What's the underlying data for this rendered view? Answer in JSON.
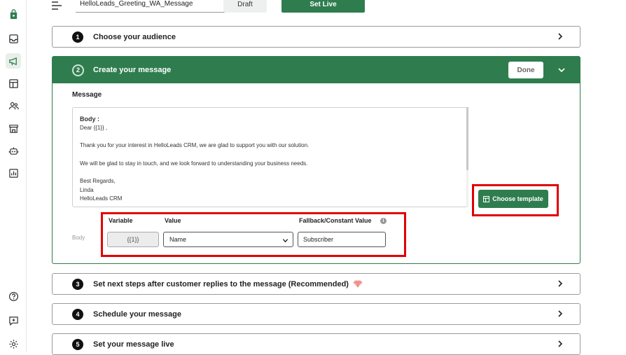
{
  "toolbar": {
    "campaign_name": "HelloLeads_Greeting_WA_Message",
    "draft_label": "Draft",
    "set_live_label": "Set Live"
  },
  "steps": [
    {
      "num": "1",
      "title": "Choose your audience"
    },
    {
      "num": "2",
      "title": "Create your message",
      "done_label": "Done"
    },
    {
      "num": "3",
      "title": "Set next steps after customer replies to the message (Recommended)"
    },
    {
      "num": "4",
      "title": "Schedule your message"
    },
    {
      "num": "5",
      "title": "Set your message live"
    }
  ],
  "message": {
    "label": "Message",
    "body_heading": "Body :",
    "line_dear": "Dear  {{1}} ,",
    "line1": "Thank you for your interest in HelloLeads CRM, we are glad to support you with our solution.",
    "line2": "We will be glad to stay in touch, and we look forward to understanding your business needs.",
    "sign1": "Best Regards,",
    "sign2": "Linda",
    "sign3": "HelloLeads CRM"
  },
  "choose_template_label": "Choose template",
  "variables": {
    "col_variable": "Variable",
    "col_value": "Value",
    "col_fallback": "Fallback/Constant Value",
    "row_label": "Body",
    "var": "{{1}}",
    "value": "Name",
    "fallback": "Subscriber"
  },
  "colors": {
    "accent": "#2f7d4f",
    "highlight": "#e10000"
  }
}
